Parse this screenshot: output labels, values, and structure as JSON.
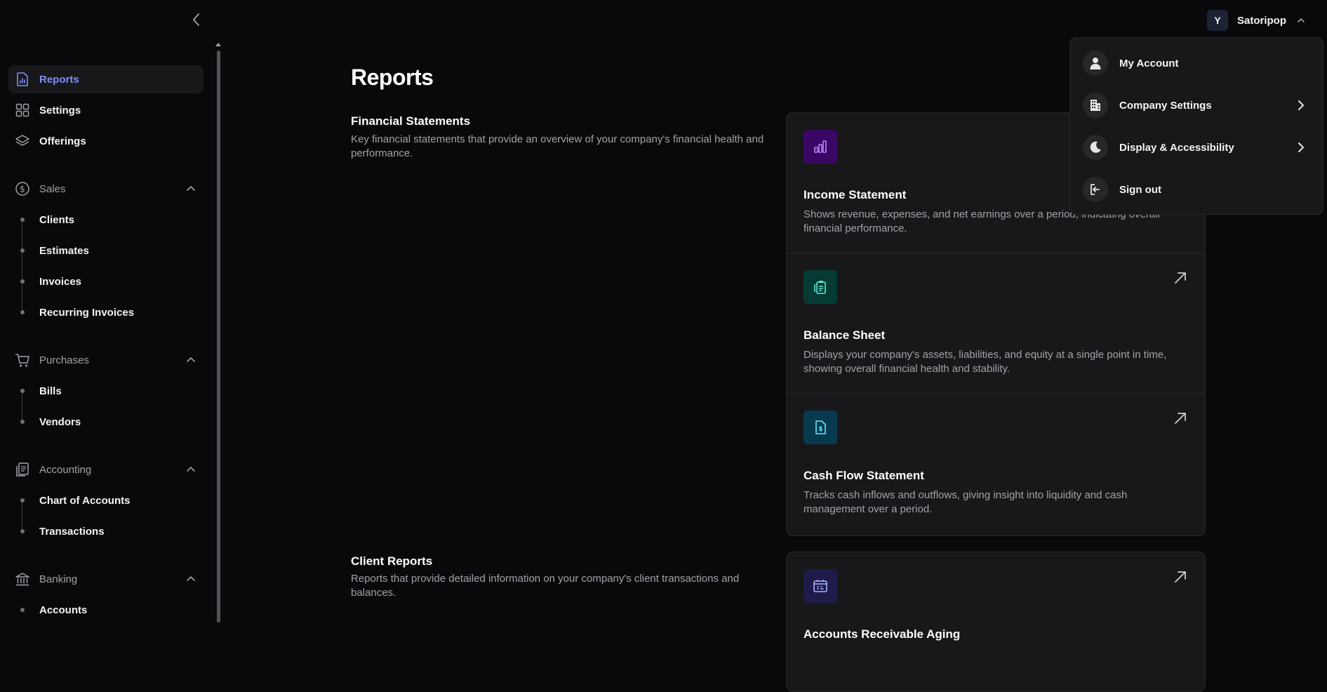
{
  "header": {
    "user_initial": "Y",
    "user_name": "Satoripop"
  },
  "user_menu": {
    "items": [
      {
        "label": "My Account",
        "icon": "user-icon"
      },
      {
        "label": "Company Settings",
        "icon": "building-icon"
      },
      {
        "label": "Display & Accessibility",
        "icon": "moon-icon"
      },
      {
        "label": "Sign out",
        "icon": "sign-out-icon"
      }
    ]
  },
  "sidebar": {
    "top_items": [
      {
        "label": "Reports",
        "icon": "report-icon",
        "active": true
      },
      {
        "label": "Settings",
        "icon": "grid-icon"
      },
      {
        "label": "Offerings",
        "icon": "layers-icon"
      }
    ],
    "groups": [
      {
        "label": "Sales",
        "icon": "dollar-icon",
        "items": [
          "Clients",
          "Estimates",
          "Invoices",
          "Recurring Invoices"
        ]
      },
      {
        "label": "Purchases",
        "icon": "cart-icon",
        "items": [
          "Bills",
          "Vendors"
        ]
      },
      {
        "label": "Accounting",
        "icon": "ledger-icon",
        "items": [
          "Chart of Accounts",
          "Transactions"
        ]
      },
      {
        "label": "Banking",
        "icon": "bank-icon",
        "items": [
          "Accounts"
        ]
      }
    ]
  },
  "main": {
    "title": "Reports",
    "sections": [
      {
        "title": "Financial Statements",
        "description": "Key financial statements that provide an overview of your company's financial health and performance.",
        "cards": [
          {
            "title": "Income Statement",
            "description": "Shows revenue, expenses, and net earnings over a period, indicating overall financial performance.",
            "icon": "bar-chart-icon",
            "color": "#3b0764",
            "icon_color": "#c084fc"
          },
          {
            "title": "Balance Sheet",
            "description": "Displays your company's assets, liabilities, and equity at a single point in time, showing overall financial health and stability.",
            "icon": "clipboard-icon",
            "color": "#053b33",
            "icon_color": "#5eead4"
          },
          {
            "title": "Cash Flow Statement",
            "description": "Tracks cash inflows and outflows, giving insight into liquidity and cash management over a period.",
            "icon": "dollar-document-icon",
            "color": "#083a4f",
            "icon_color": "#67e8f9"
          }
        ]
      },
      {
        "title": "Client Reports",
        "description": "Reports that provide detailed information on your company's client transactions and balances.",
        "cards": [
          {
            "title": "Accounts Receivable Aging",
            "icon": "calendar-icon",
            "color": "#1e1b4b",
            "icon_color": "#a5b4fc"
          }
        ]
      }
    ]
  }
}
